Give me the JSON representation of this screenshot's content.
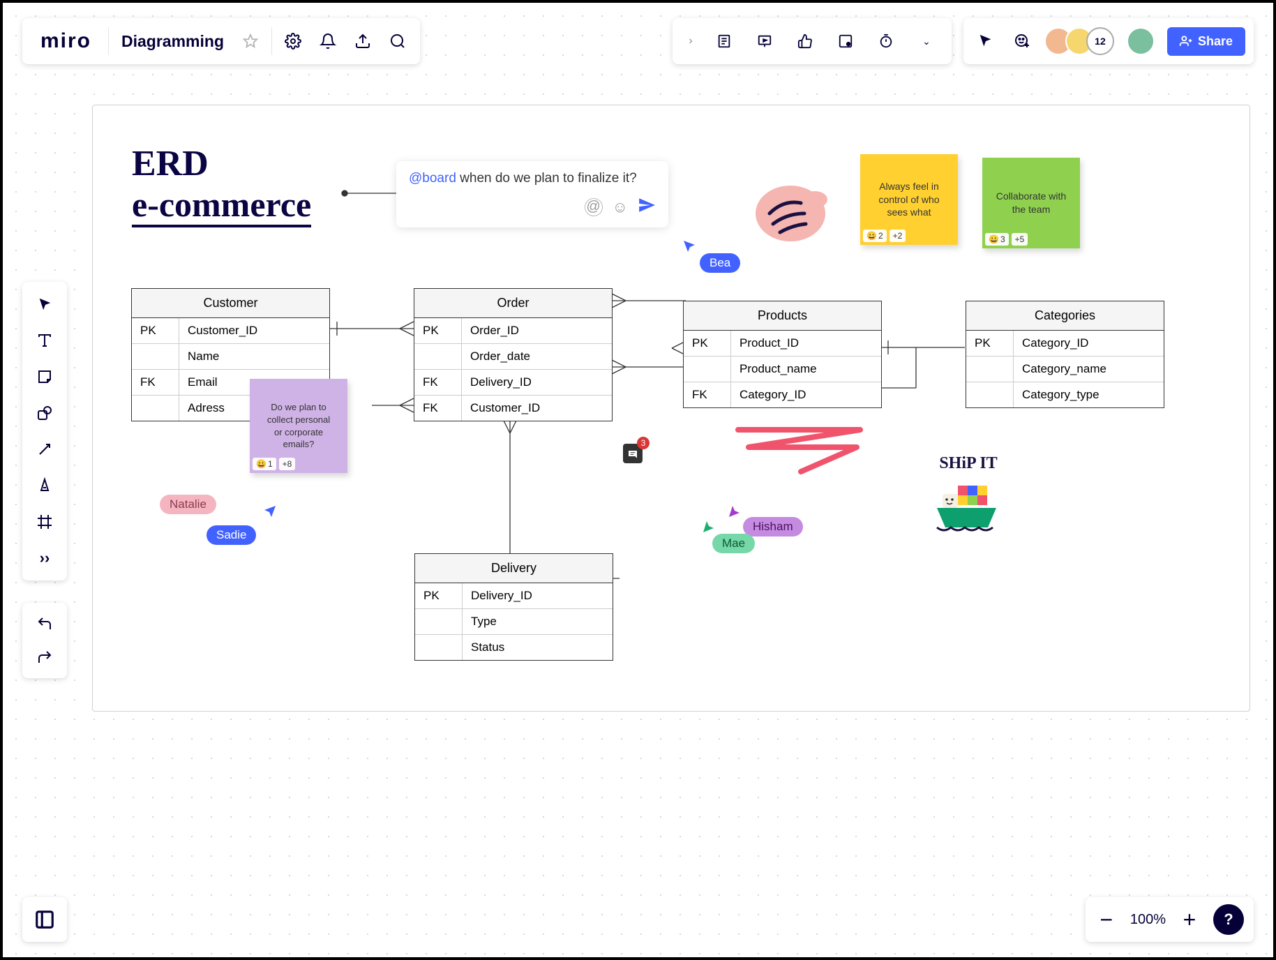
{
  "app": {
    "logo": "miro",
    "board_title": "Diagramming"
  },
  "header": {
    "share_label": "Share",
    "user_count": "12"
  },
  "zoom": {
    "value": "100%"
  },
  "title": {
    "line1": "ERD",
    "line2": "e-commerce"
  },
  "comment": {
    "mention": "@board",
    "text": " when do we plan to finalize it?"
  },
  "stickies": {
    "yellow": {
      "text": "Always feel in control of who sees what",
      "r1": "2",
      "r2": "+2"
    },
    "green": {
      "text": "Collaborate with the team",
      "r1": "3",
      "r2": "+5"
    },
    "purple": {
      "text": "Do we plan to collect personal or corporate emails?",
      "r1": "1",
      "r2": "+8"
    }
  },
  "cursors": {
    "bea": "Bea",
    "natalie": "Natalie",
    "sadie": "Sadie",
    "hisham": "Hisham",
    "mae": "Mae"
  },
  "ship_label": "SHiP IT",
  "chat_count": "3",
  "tables": {
    "customer": {
      "name": "Customer",
      "rows": [
        {
          "key": "PK",
          "field": "Customer_ID"
        },
        {
          "key": "",
          "field": "Name"
        },
        {
          "key": "FK",
          "field": "Email"
        },
        {
          "key": "",
          "field": "Adress"
        }
      ]
    },
    "order": {
      "name": "Order",
      "rows": [
        {
          "key": "PK",
          "field": "Order_ID"
        },
        {
          "key": "",
          "field": "Order_date"
        },
        {
          "key": "FK",
          "field": "Delivery_ID"
        },
        {
          "key": "FK",
          "field": "Customer_ID"
        }
      ]
    },
    "products": {
      "name": "Products",
      "rows": [
        {
          "key": "PK",
          "field": "Product_ID"
        },
        {
          "key": "",
          "field": "Product_name"
        },
        {
          "key": "FK",
          "field": "Category_ID"
        }
      ]
    },
    "categories": {
      "name": "Categories",
      "rows": [
        {
          "key": "PK",
          "field": "Category_ID"
        },
        {
          "key": "",
          "field": "Category_name"
        },
        {
          "key": "",
          "field": "Category_type"
        }
      ]
    },
    "delivery": {
      "name": "Delivery",
      "rows": [
        {
          "key": "PK",
          "field": "Delivery_ID"
        },
        {
          "key": "",
          "field": "Type"
        },
        {
          "key": "",
          "field": "Status"
        }
      ]
    }
  }
}
